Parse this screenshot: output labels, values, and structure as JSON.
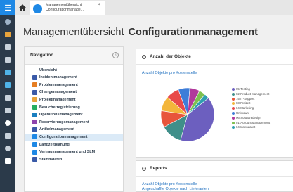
{
  "tab": {
    "line1": "Managementübersicht",
    "line2": "Configurationmanage...",
    "close_label": "×"
  },
  "header": {
    "title_light": "Managementübersicht",
    "title_bold": "Configurationmanagement"
  },
  "navigation": {
    "title": "Navigation",
    "collapse_icon": "«",
    "items": [
      {
        "label": "Übersicht",
        "icon": "none",
        "color": ""
      },
      {
        "label": "Incidentmanagement",
        "icon": "book-icon",
        "color": "#3a5aa8"
      },
      {
        "label": "Problemmanagement",
        "icon": "warning-icon",
        "color": "#e67e22"
      },
      {
        "label": "Changemanagement",
        "icon": "change-icon",
        "color": "#3a5aa8"
      },
      {
        "label": "Projektmanagement",
        "icon": "pencil-icon",
        "color": "#e8a33b"
      },
      {
        "label": "Besucherregistrierung",
        "icon": "visitor-icon",
        "color": "#27ae60"
      },
      {
        "label": "Operationsmanagement",
        "icon": "operations-icon",
        "color": "#1a7fc0"
      },
      {
        "label": "Reservierungsmanagement",
        "icon": "reservation-icon",
        "color": "#8e44ad"
      },
      {
        "label": "Artikelmanagement",
        "icon": "article-icon",
        "color": "#3a5aa8"
      },
      {
        "label": "Configurationmanagement",
        "icon": "config-icon",
        "color": "#1e88e5",
        "active": true
      },
      {
        "label": "Langzeitplanung",
        "icon": "arrow-up-icon",
        "color": "#1e88e5"
      },
      {
        "label": "Vertragsmanagement und SLM",
        "icon": "contract-icon",
        "color": "#1e88e5"
      },
      {
        "label": "Stammdaten",
        "icon": "person-icon",
        "color": "#3a5aa8"
      }
    ]
  },
  "panel_count": {
    "collapse_icon": "›",
    "title": "Anzahl der Objekte",
    "link": "Anzahl Objekte pro Kostenstelle"
  },
  "panel_reports": {
    "collapse_icon": "›",
    "title": "Reports",
    "link1": "Anzahl Objekte pro Kostenstelle",
    "link2": "Angeschaffte Objekte nach Lieferanten"
  },
  "chart_data": {
    "type": "pie",
    "title": "Anzahl Objekte pro Kostenstelle",
    "slices": [
      {
        "label": "05-Testing",
        "value": 40,
        "color": "#6c5fbf"
      },
      {
        "label": "02-Product Management",
        "value": 13,
        "color": "#3f8f8a"
      },
      {
        "label": "75-IT-Support",
        "value": 10,
        "color": "#e8553b"
      },
      {
        "label": "03-Freizeit",
        "value": 9,
        "color": "#f3b63b"
      },
      {
        "label": "04-Marketing",
        "value": 8,
        "color": "#e84a4a"
      },
      {
        "label": "Unknown",
        "value": 7,
        "color": "#3e7dd8"
      },
      {
        "label": "06-Softwaredesign",
        "value": 6,
        "color": "#b1399c"
      },
      {
        "label": "01-Account Management",
        "value": 4,
        "color": "#7dc04f"
      },
      {
        "label": "04-Insendanst",
        "value": 3,
        "color": "#2e9fb0"
      }
    ]
  }
}
